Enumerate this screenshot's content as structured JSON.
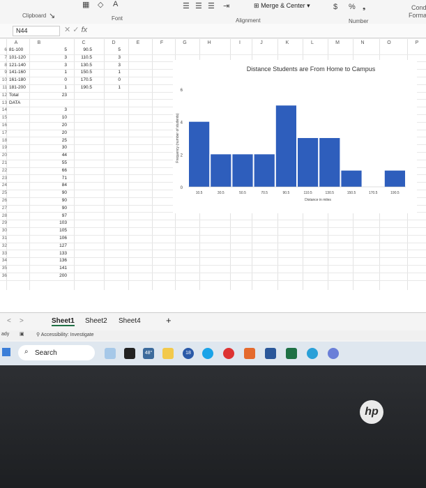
{
  "ribbon": {
    "clipboard": "Clipboard",
    "font": "Font",
    "alignment": "Alignment",
    "merge_center": "Merge & Center",
    "number": "Number",
    "currency": "$",
    "percent": "%",
    "cond_format_line1": "Cond",
    "cond_format_line2": "Forma"
  },
  "formula_bar": {
    "name_box": "N44",
    "fx": "fx",
    "value": ""
  },
  "columns": [
    "A",
    "B",
    "C",
    "D",
    "E",
    "F",
    "G",
    "H",
    "I",
    "J",
    "K",
    "L",
    "M",
    "N",
    "O",
    "P"
  ],
  "rows": [
    {
      "n": "6",
      "a": "81-100",
      "b": "5",
      "c": "90.5",
      "d": "5"
    },
    {
      "n": "7",
      "a": "101-120",
      "b": "3",
      "c": "110.5",
      "d": "3"
    },
    {
      "n": "8",
      "a": "121-140",
      "b": "3",
      "c": "130.5",
      "d": "3"
    },
    {
      "n": "9",
      "a": "141-160",
      "b": "1",
      "c": "150.5",
      "d": "1"
    },
    {
      "n": "10",
      "a": "161-180",
      "b": "0",
      "c": "170.5",
      "d": "0"
    },
    {
      "n": "11",
      "a": "181-200",
      "b": "1",
      "c": "190.5",
      "d": "1"
    },
    {
      "n": "12",
      "a": "Total",
      "b": "23",
      "c": "",
      "d": ""
    },
    {
      "n": "13",
      "a": "DATA",
      "b": "",
      "c": "",
      "d": ""
    },
    {
      "n": "14",
      "a": "",
      "b": "3",
      "c": "",
      "d": ""
    },
    {
      "n": "15",
      "a": "",
      "b": "10",
      "c": "",
      "d": ""
    },
    {
      "n": "16",
      "a": "",
      "b": "20",
      "c": "",
      "d": ""
    },
    {
      "n": "17",
      "a": "",
      "b": "20",
      "c": "",
      "d": ""
    },
    {
      "n": "18",
      "a": "",
      "b": "25",
      "c": "",
      "d": ""
    },
    {
      "n": "19",
      "a": "",
      "b": "30",
      "c": "",
      "d": ""
    },
    {
      "n": "20",
      "a": "",
      "b": "44",
      "c": "",
      "d": ""
    },
    {
      "n": "21",
      "a": "",
      "b": "55",
      "c": "",
      "d": ""
    },
    {
      "n": "22",
      "a": "",
      "b": "66",
      "c": "",
      "d": ""
    },
    {
      "n": "23",
      "a": "",
      "b": "71",
      "c": "",
      "d": ""
    },
    {
      "n": "24",
      "a": "",
      "b": "84",
      "c": "",
      "d": ""
    },
    {
      "n": "25",
      "a": "",
      "b": "90",
      "c": "",
      "d": ""
    },
    {
      "n": "26",
      "a": "",
      "b": "90",
      "c": "",
      "d": ""
    },
    {
      "n": "27",
      "a": "",
      "b": "90",
      "c": "",
      "d": ""
    },
    {
      "n": "28",
      "a": "",
      "b": "97",
      "c": "",
      "d": ""
    },
    {
      "n": "29",
      "a": "",
      "b": "103",
      "c": "",
      "d": ""
    },
    {
      "n": "30",
      "a": "",
      "b": "105",
      "c": "",
      "d": ""
    },
    {
      "n": "31",
      "a": "",
      "b": "106",
      "c": "",
      "d": ""
    },
    {
      "n": "32",
      "a": "",
      "b": "127",
      "c": "",
      "d": ""
    },
    {
      "n": "33",
      "a": "",
      "b": "133",
      "c": "",
      "d": ""
    },
    {
      "n": "34",
      "a": "",
      "b": "136",
      "c": "",
      "d": ""
    },
    {
      "n": "35",
      "a": "",
      "b": "141",
      "c": "",
      "d": ""
    },
    {
      "n": "36",
      "a": "",
      "b": "200",
      "c": "",
      "d": ""
    }
  ],
  "chart_data": {
    "type": "bar",
    "title": "Distance Students are From Home to Campus",
    "xlabel": "Distance in miles",
    "ylabel": "Frequency (number of students)",
    "categories": [
      "10.5",
      "30.5",
      "50.5",
      "70.5",
      "90.5",
      "110.5",
      "130.5",
      "150.5",
      "170.5",
      "190.5"
    ],
    "values": [
      4,
      2,
      2,
      2,
      5,
      3,
      3,
      1,
      0,
      1
    ],
    "yticks": [
      0,
      1,
      2,
      3,
      4,
      5,
      6
    ],
    "ylim": [
      0,
      6
    ],
    "bar_color": "#2e5ebc"
  },
  "sheets": [
    "Sheet1",
    "Sheet2",
    "Sheet4"
  ],
  "active_sheet": "Sheet1",
  "status": {
    "ready": "ady",
    "accessibility": "Accessibility: Investigate"
  },
  "taskbar": {
    "search": "Search",
    "weather": "48°",
    "badge": "18"
  },
  "brand": "hp"
}
